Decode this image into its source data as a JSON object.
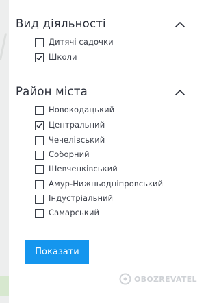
{
  "filters": {
    "activity": {
      "title": "Вид діяльності",
      "chevron_icon": "chevron-up-icon",
      "options": [
        {
          "label": "Дитячі садочки",
          "checked": false
        },
        {
          "label": "Школи",
          "checked": true
        }
      ]
    },
    "district": {
      "title": "Район міста",
      "chevron_icon": "chevron-up-icon",
      "options": [
        {
          "label": "Новокодацький",
          "checked": false
        },
        {
          "label": "Центральний",
          "checked": true
        },
        {
          "label": "Чечелівський",
          "checked": false
        },
        {
          "label": "Соборний",
          "checked": false
        },
        {
          "label": "Шевченківський",
          "checked": false
        },
        {
          "label": "Амур-Нижньодніпровський",
          "checked": false
        },
        {
          "label": "Індустріальний",
          "checked": false
        },
        {
          "label": "Самарський",
          "checked": false
        }
      ]
    }
  },
  "submit": {
    "label": "Показати"
  },
  "watermark": {
    "text": "OBOZREVATEL"
  },
  "colors": {
    "button_bg": "#1596ee",
    "text": "#2b2f3a",
    "checkbox_border": "#3a3f48"
  }
}
